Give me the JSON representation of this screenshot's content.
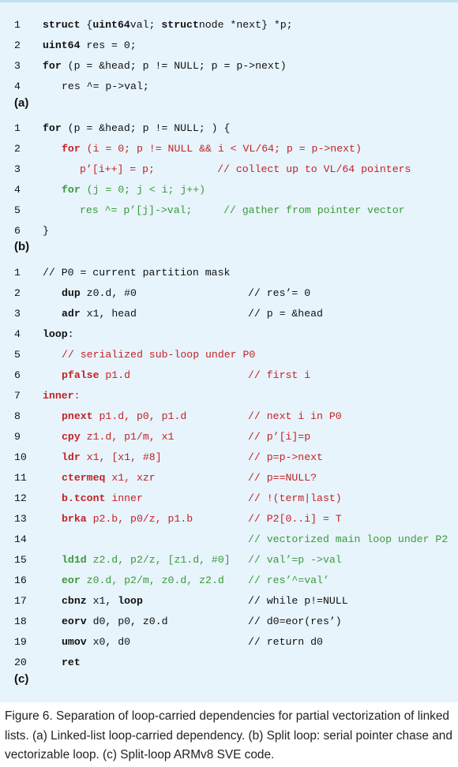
{
  "section_a": {
    "label": "(a)",
    "lines": [
      {
        "n": "1",
        "color": "black",
        "indent": 0,
        "code": [
          [
            "b",
            "struct"
          ],
          [
            "t",
            " {"
          ],
          [
            "b",
            "uint64"
          ],
          [
            "t",
            "val; "
          ],
          [
            "b",
            "struct"
          ],
          [
            "t",
            "node *next} *p;"
          ]
        ],
        "comment": ""
      },
      {
        "n": "2",
        "color": "black",
        "indent": 0,
        "code": [
          [
            "b",
            "uint64"
          ],
          [
            "t",
            " res = 0;"
          ]
        ],
        "comment": ""
      },
      {
        "n": "3",
        "color": "black",
        "indent": 0,
        "code": [
          [
            "b",
            "for"
          ],
          [
            "t",
            " (p = &head; p != NULL; p = p->next)"
          ]
        ],
        "comment": ""
      },
      {
        "n": "4",
        "color": "black",
        "indent": 1,
        "code": [
          [
            "t",
            "res ^= p->val;"
          ]
        ],
        "comment": ""
      }
    ]
  },
  "section_b": {
    "label": "(b)",
    "lines": [
      {
        "n": "1",
        "color": "black",
        "indent": 0,
        "code": [
          [
            "b",
            "for"
          ],
          [
            "t",
            " (p = &head; p != NULL; ) {"
          ]
        ],
        "comment": ""
      },
      {
        "n": "2",
        "color": "red",
        "indent": 1,
        "code": [
          [
            "b",
            "for"
          ],
          [
            "t",
            " (i = 0; p != NULL && i < VL/64; p = p->next)"
          ]
        ],
        "comment": ""
      },
      {
        "n": "3",
        "color": "red",
        "indent": 2,
        "code": [
          [
            "t",
            "p’[i++] = p;          // collect up to VL/64 pointers"
          ]
        ],
        "comment": ""
      },
      {
        "n": "4",
        "color": "green",
        "indent": 1,
        "code": [
          [
            "b",
            "for"
          ],
          [
            "t",
            " (j = 0; j < i; j++)"
          ]
        ],
        "comment": ""
      },
      {
        "n": "5",
        "color": "green",
        "indent": 2,
        "code": [
          [
            "t",
            "res ^= p’[j]->val;     // gather from pointer vector"
          ]
        ],
        "comment": ""
      },
      {
        "n": "6",
        "color": "black",
        "indent": 0,
        "code": [
          [
            "t",
            "}"
          ]
        ],
        "comment": ""
      }
    ]
  },
  "section_c": {
    "label": "(c)",
    "lines": [
      {
        "n": "1",
        "color": "black",
        "indent": 0,
        "code": [
          [
            "t",
            "// P0 = current partition mask"
          ]
        ],
        "comment": ""
      },
      {
        "n": "2",
        "color": "black",
        "indent": 1,
        "code": [
          [
            "b",
            "dup"
          ],
          [
            "t",
            " z0.d, #0"
          ]
        ],
        "comment": "// res’= 0"
      },
      {
        "n": "3",
        "color": "black",
        "indent": 1,
        "code": [
          [
            "b",
            "adr"
          ],
          [
            "t",
            " x1, head"
          ]
        ],
        "comment": "// p = &head"
      },
      {
        "n": "4",
        "color": "black",
        "indent": 0,
        "code": [
          [
            "b",
            "loop"
          ],
          [
            "t",
            ":"
          ]
        ],
        "comment": ""
      },
      {
        "n": "5",
        "color": "red",
        "indent": 1,
        "code": [
          [
            "t",
            "// serialized sub-loop under P0"
          ]
        ],
        "comment": ""
      },
      {
        "n": "6",
        "color": "red",
        "indent": 1,
        "code": [
          [
            "b",
            "pfalse"
          ],
          [
            "t",
            " p1.d"
          ]
        ],
        "comment": "// first i"
      },
      {
        "n": "7",
        "color": "red",
        "indent": 0,
        "code": [
          [
            "b",
            "inner"
          ],
          [
            "t",
            ":"
          ]
        ],
        "comment": ""
      },
      {
        "n": "8",
        "color": "red",
        "indent": 1,
        "code": [
          [
            "b",
            "pnext"
          ],
          [
            "t",
            " p1.d, p0, p1.d"
          ]
        ],
        "comment": "// next i in P0"
      },
      {
        "n": "9",
        "color": "red",
        "indent": 1,
        "code": [
          [
            "b",
            "cpy"
          ],
          [
            "t",
            " z1.d, p1/m, x1"
          ]
        ],
        "comment": "// p’[i]=p"
      },
      {
        "n": "10",
        "color": "red",
        "indent": 1,
        "code": [
          [
            "b",
            "ldr"
          ],
          [
            "t",
            " x1, [x1, #8]"
          ]
        ],
        "comment": "// p=p->next"
      },
      {
        "n": "11",
        "color": "red",
        "indent": 1,
        "code": [
          [
            "b",
            "ctermeq"
          ],
          [
            "t",
            " x1, xzr"
          ]
        ],
        "comment": "// p==NULL?"
      },
      {
        "n": "12",
        "color": "red",
        "indent": 1,
        "code": [
          [
            "b",
            "b.tcont"
          ],
          [
            "t",
            " inner"
          ]
        ],
        "comment": "// !(term|last)"
      },
      {
        "n": "13",
        "color": "red",
        "indent": 1,
        "code": [
          [
            "b",
            "brka"
          ],
          [
            "t",
            " p2.b, p0/z, p1.b"
          ]
        ],
        "comment": "// P2[0..i] = T"
      },
      {
        "n": "14",
        "color": "green",
        "indent": 1,
        "code": [],
        "comment": "// vectorized main loop under P2"
      },
      {
        "n": "15",
        "color": "green",
        "indent": 1,
        "code": [
          [
            "b",
            "ld1d"
          ],
          [
            "t",
            " z2.d, p2/z, [z1.d, #0]"
          ]
        ],
        "comment": "// val’=p ->val"
      },
      {
        "n": "16",
        "color": "green",
        "indent": 1,
        "code": [
          [
            "b",
            "eor"
          ],
          [
            "t",
            " z0.d, p2/m, z0.d, z2.d"
          ]
        ],
        "comment": "// res’^=val’"
      },
      {
        "n": "17",
        "color": "black",
        "indent": 1,
        "code": [
          [
            "b",
            "cbnz"
          ],
          [
            "t",
            " x1, "
          ],
          [
            "b",
            "loop"
          ]
        ],
        "comment": "// while p!=NULL"
      },
      {
        "n": "18",
        "color": "black",
        "indent": 1,
        "code": [
          [
            "b",
            "eorv"
          ],
          [
            "t",
            " d0, p0, z0.d"
          ]
        ],
        "comment": "// d0=eor(res’)"
      },
      {
        "n": "19",
        "color": "black",
        "indent": 1,
        "code": [
          [
            "b",
            "umov"
          ],
          [
            "t",
            " x0, d0"
          ]
        ],
        "comment": "// return d0"
      },
      {
        "n": "20",
        "color": "black",
        "indent": 1,
        "code": [
          [
            "b",
            "ret"
          ]
        ],
        "comment": ""
      }
    ]
  },
  "caption": "Figure 6. Separation of loop-carried dependencies for partial vectorization of linked lists. (a) Linked-list loop-carried dependency. (b) Split loop: serial pointer chase and vectorizable loop. (c) Split-loop ARMv8 SVE code."
}
